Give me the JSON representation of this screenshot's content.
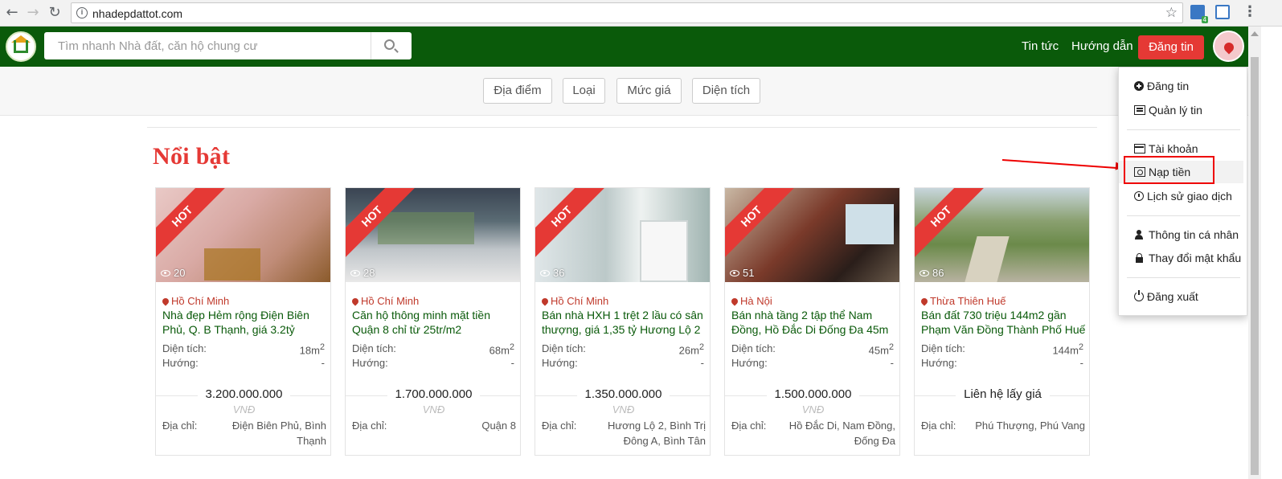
{
  "browser": {
    "url": "nhadepdattot.com",
    "ext_badge": "4"
  },
  "header": {
    "search_placeholder": "Tìm nhanh Nhà đất, căn hộ chung cư",
    "nav_news": "Tin tức",
    "nav_guide": "Hướng dẫn",
    "post_button": "Đăng tin"
  },
  "filters": [
    "Địa điểm",
    "Loại",
    "Mức giá",
    "Diện tích"
  ],
  "section_title": "Nổi bật",
  "labels": {
    "hot": "HOT",
    "area": "Diện tích:",
    "direction": "Hướng:",
    "address": "Địa chỉ:",
    "currency": "VNĐ"
  },
  "listings": [
    {
      "views": "20",
      "location": "Hồ Chí Minh",
      "title": "Nhà đẹp Hẻm rộng Điện Biên Phủ, Q. B Thạnh, giá 3.2tỷ",
      "area": "18m",
      "direction": "-",
      "price": "3.200.000.000",
      "address": "Điện Biên Phủ, Bình Thạnh"
    },
    {
      "views": "28",
      "location": "Hồ Chí Minh",
      "title": "Căn hộ thông minh mặt tiền Quận 8 chỉ từ 25tr/m2",
      "area": "68m",
      "direction": "-",
      "price": "1.700.000.000",
      "address": "Quận 8"
    },
    {
      "views": "36",
      "location": "Hồ Chí Minh",
      "title": "Bán nhà HXH 1 trệt 2 lầu có sân thượng, giá 1,35 tỷ Hương Lộ 2",
      "area": "26m",
      "direction": "-",
      "price": "1.350.000.000",
      "address": "Hương Lộ 2, Bình Trị Đông A, Bình Tân"
    },
    {
      "views": "51",
      "location": "Hà Nội",
      "title": "Bán nhà tầng 2 tập thể Nam Đồng, Hồ Đắc Di Đống Đa 45m",
      "area": "45m",
      "direction": "-",
      "price": "1.500.000.000",
      "address": "Hồ Đắc Di, Nam Đồng, Đống Đa"
    },
    {
      "views": "86",
      "location": "Thừa Thiên Huế",
      "title": "Bán đất 730 triệu 144m2 gần Phạm Văn Đồng Thành Phố Huế",
      "area": "144m",
      "direction": "-",
      "price": "Liên hệ lấy giá",
      "address": "Phú Thượng, Phú Vang"
    }
  ],
  "user_menu": {
    "post": "Đăng tin",
    "manage": "Quản lý tin",
    "account": "Tài khoản",
    "topup": "Nạp tiền",
    "history": "Lịch sử giao dịch",
    "profile": "Thông tin cá nhân",
    "password": "Thay đổi mật khẩu",
    "logout": "Đăng xuất"
  },
  "colors": {
    "header_green": "#0a5a0a",
    "accent_red": "#e53935",
    "title_green": "#0a5a0a"
  }
}
